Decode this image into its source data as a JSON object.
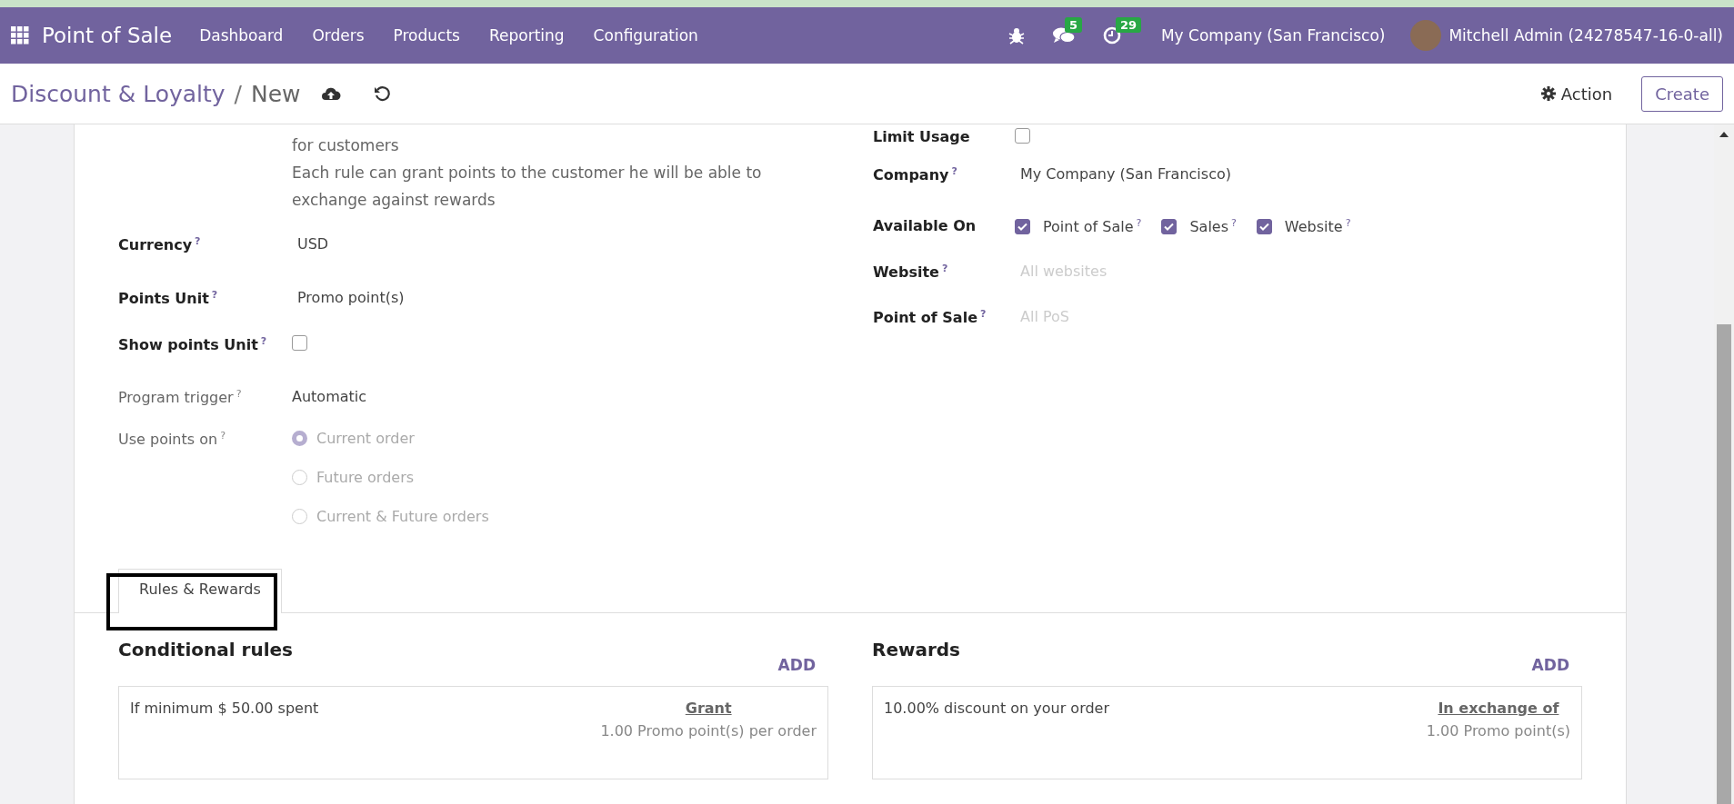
{
  "navbar": {
    "app_title": "Point of Sale",
    "menu": [
      "Dashboard",
      "Orders",
      "Products",
      "Reporting",
      "Configuration"
    ],
    "messages_badge": "5",
    "activities_badge": "29",
    "company": "My Company (San Francisco)",
    "user": "Mitchell Admin (24278547-16-0-all)"
  },
  "control_panel": {
    "breadcrumb": "Discount & Loyalty",
    "separator": "/",
    "current": "New",
    "action": "Action",
    "create": "Create"
  },
  "left_description": [
    "for customers",
    "Each rule can grant points to the customer he will be able to exchange against rewards"
  ],
  "left_fields": [
    {
      "kind": "text",
      "label": "Currency",
      "help": "?",
      "value": "USD",
      "readonly": false
    },
    {
      "kind": "text",
      "label": "Points Unit",
      "help": "?",
      "value": "Promo point(s)",
      "readonly": false
    },
    {
      "kind": "checkbox",
      "label": "Show points Unit",
      "help": "?",
      "checked": false,
      "readonly": false
    },
    {
      "kind": "plain",
      "label": "Program trigger",
      "help": "?",
      "value": "Automatic",
      "readonly": true
    },
    {
      "kind": "radio",
      "label": "Use points on",
      "help": "?",
      "readonly": true,
      "options": [
        {
          "label": "Current order",
          "selected": true
        },
        {
          "label": "Future orders",
          "selected": false
        },
        {
          "label": "Current & Future orders",
          "selected": false
        }
      ]
    }
  ],
  "right_fields": [
    {
      "kind": "checkbox",
      "label": "Limit Usage",
      "checked": false
    },
    {
      "kind": "text",
      "label": "Company",
      "help": "?",
      "value": "My Company (San Francisco)"
    },
    {
      "kind": "checks",
      "label": "Available On",
      "options": [
        {
          "label": "Point of Sale",
          "help": "?",
          "checked": true
        },
        {
          "label": "Sales",
          "help": "?",
          "checked": true
        },
        {
          "label": "Website",
          "help": "?",
          "checked": true
        }
      ]
    },
    {
      "kind": "placeholder",
      "label": "Website",
      "help": "?",
      "placeholder": "All websites"
    },
    {
      "kind": "placeholder",
      "label": "Point of Sale",
      "help": "?",
      "placeholder": "All PoS"
    }
  ],
  "tabs": [
    {
      "label": "Rules & Rewards",
      "selected": true,
      "highlighted": true
    }
  ],
  "sections": [
    {
      "title": "Conditional rules",
      "add": "ADD",
      "card": {
        "text": "If minimum $ 50.00 spent",
        "link": "Grant",
        "detail": "1.00 Promo point(s) per order"
      }
    },
    {
      "title": "Rewards",
      "add": "ADD",
      "card": {
        "text": "10.00% discount on your order",
        "link": "In exchange of",
        "detail": "1.00 Promo point(s)"
      }
    }
  ]
}
